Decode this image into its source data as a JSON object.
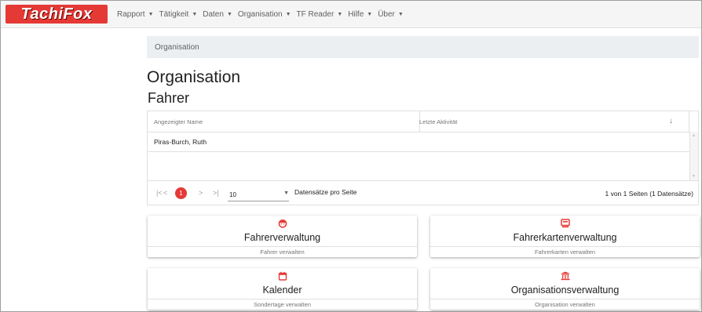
{
  "app": {
    "logo_text": "TachiFox",
    "accent": "#e53935"
  },
  "nav": [
    {
      "label": "Rapport"
    },
    {
      "label": "Tätigkeit"
    },
    {
      "label": "Daten"
    },
    {
      "label": "Organisation"
    },
    {
      "label": "TF Reader"
    },
    {
      "label": "Hilfe"
    },
    {
      "label": "Über"
    }
  ],
  "breadcrumb": {
    "label": "Organisation"
  },
  "page": {
    "title": "Organisation",
    "section": "Fahrer"
  },
  "table": {
    "columns": [
      "Angezeigter Name",
      "Letzte Aktivität"
    ],
    "sort_icon": "arrow-down-icon",
    "rows": [
      {
        "name": "Piras-Burch, Ruth",
        "activity": ""
      }
    ],
    "pager": {
      "first": "|<",
      "prev": "<",
      "current": "1",
      "next": ">",
      "last": ">|",
      "page_size": "10",
      "page_size_label": "Datensätze pro Seite",
      "info": "1 von 1 Seiten (1 Datensätze)"
    }
  },
  "cards": [
    {
      "icon": "driver-face-icon",
      "title": "Fahrerverwaltung",
      "subtitle": "Fahrer verwalten"
    },
    {
      "icon": "driver-card-icon",
      "title": "Fahrerkartenverwaltung",
      "subtitle": "Fahrerkarten verwalten"
    },
    {
      "icon": "calendar-icon",
      "title": "Kalender",
      "subtitle": "Sondertage verwalten"
    },
    {
      "icon": "institution-icon",
      "title": "Organisationsverwaltung",
      "subtitle": "Organisation verwalten"
    }
  ]
}
